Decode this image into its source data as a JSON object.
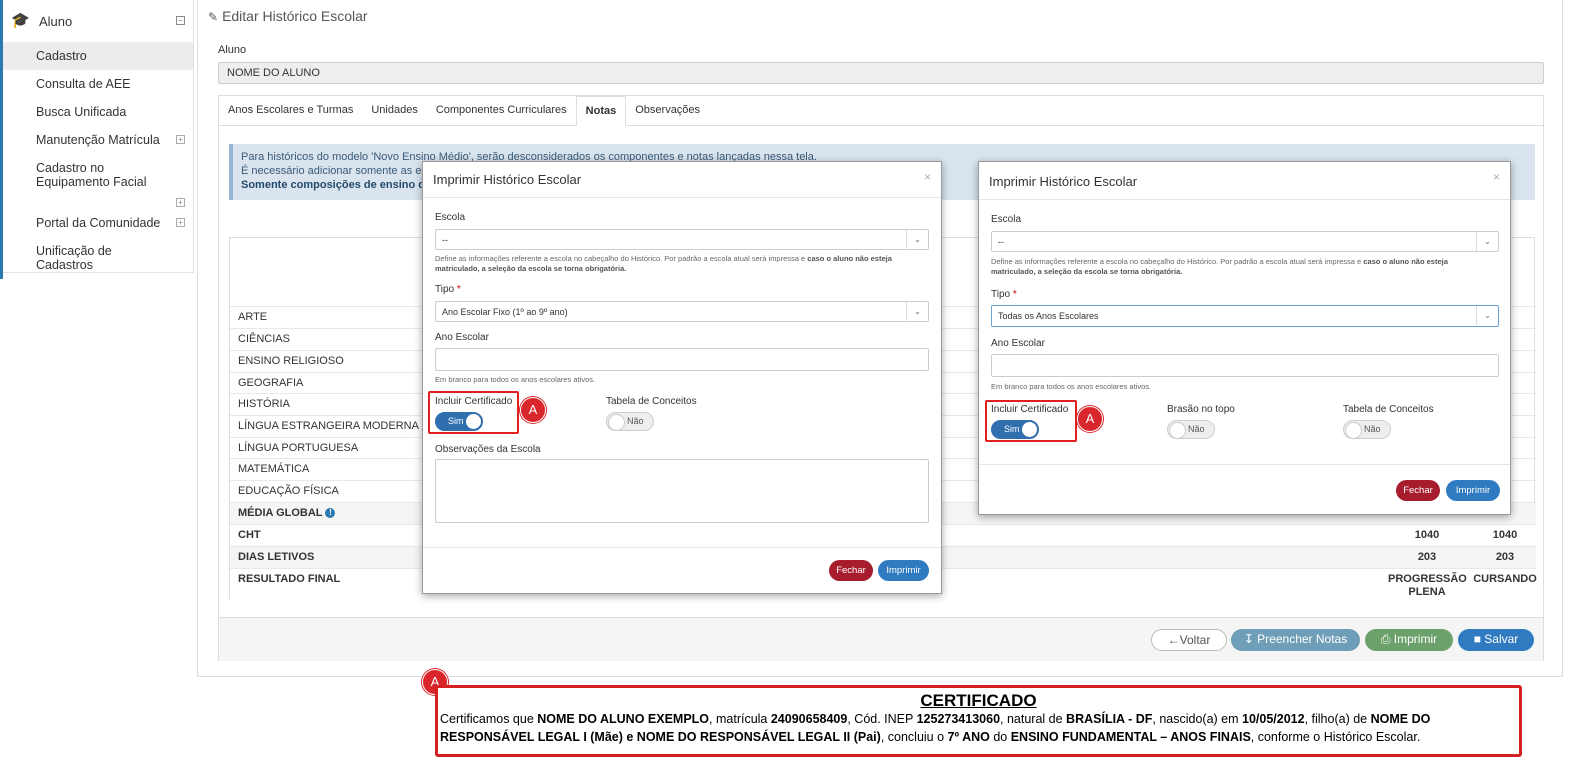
{
  "sidebar": {
    "section": "Aluno",
    "items": [
      {
        "label": "Cadastro"
      },
      {
        "label": "Consulta de AEE"
      },
      {
        "label": "Busca Unificada"
      },
      {
        "label": "Manutenção Matrícula"
      },
      {
        "label": "Cadastro no Equipamento Facial"
      },
      {
        "label": "Portal da Comunidade"
      },
      {
        "label": "Unificação de Cadastros"
      }
    ]
  },
  "page": {
    "title": "Editar Histórico Escolar",
    "aluno_label": "Aluno",
    "aluno_value": "NOME DO ALUNO"
  },
  "tabs": [
    "Anos Escolares e Turmas",
    "Unidades",
    "Componentes Curriculares",
    "Notas",
    "Observações"
  ],
  "info": {
    "line1": "Para históricos do modelo 'Novo Ensino Médio', serão desconsiderados os componentes e notas lançadas nessa tela.",
    "line2": "É necessário adicionar somente as escola",
    "line3": "Somente composições de ensino do tip"
  },
  "grades": {
    "subjects": [
      "ARTE",
      "CIÊNCIAS",
      "ENSINO RELIGIOSO",
      "GEOGRAFIA",
      "HISTÓRIA",
      "LÍNGUA ESTRANGEIRA MODERNA - INGLÊ",
      "LÍNGUA PORTUGUESA",
      "MATEMÁTICA",
      "EDUCAÇÃO FÍSICA"
    ],
    "media_global": "MÉDIA GLOBAL",
    "cht_label": "CHT",
    "cht_values": [
      "1040",
      "1040"
    ],
    "dias_label": "DIAS LETIVOS",
    "dias_values": [
      "203",
      "203"
    ],
    "resultado_label": "RESULTADO FINAL",
    "resultado_values": [
      "PROGRESSÃO PLENA",
      "CURSANDO"
    ]
  },
  "footer_buttons": {
    "voltar": "Voltar",
    "preencher": "Preencher Notas",
    "imprimir": "Imprimir",
    "salvar": "Salvar"
  },
  "modal1": {
    "title": "Imprimir Histórico Escolar",
    "escola_label": "Escola",
    "escola_value": "--",
    "escola_help_a": "Define as informações referente a escola no cabeçalho do Histórico. Por padrão a escola atual será impressa e ",
    "escola_help_b": "caso o aluno não esteja matriculado, a seleção da escola se torna obrigatória.",
    "tipo_label": "Tipo",
    "tipo_req": "*",
    "tipo_value": "Ano Escolar Fixo (1º ao 9º ano)",
    "ano_label": "Ano Escolar",
    "ano_help": "Em branco para todos os anos escolares ativos.",
    "certificado_label": "Incluir Certificado",
    "certificado_value": "Sim",
    "conceitos_label": "Tabela de Conceitos",
    "conceitos_value": "Não",
    "obs_label": "Observações da Escola",
    "fechar": "Fechar",
    "imprimir": "Imprimir",
    "close": "×"
  },
  "modal2": {
    "title": "Imprimir Histórico Escolar",
    "escola_label": "Escola",
    "escola_value": "--",
    "escola_help_a": "Define as informações referente a escola no cabeçalho do Histórico. Por padrão a escola atual será impressa e ",
    "escola_help_b": "caso o aluno não esteja matriculado, a seleção da escola se torna obrigatória.",
    "tipo_label": "Tipo",
    "tipo_req": "*",
    "tipo_value": "Todas os Anos Escolares",
    "ano_label": "Ano Escolar",
    "ano_help": "Em branco para todos os anos escolares ativos.",
    "certificado_label": "Incluir Certificado",
    "certificado_value": "Sim",
    "brasao_label": "Brasão no topo",
    "brasao_value": "Não",
    "conceitos_label": "Tabela de Conceitos",
    "conceitos_value": "Não",
    "fechar": "Fechar",
    "imprimir": "Imprimir",
    "close": "×"
  },
  "badges": [
    "A",
    "A",
    "A"
  ],
  "certificate": {
    "title": "CERTIFICADO",
    "t1": "Certificamos que ",
    "nome": "NOME DO ALUNO EXEMPLO",
    "t2": ", matrícula ",
    "matricula": "24090658409",
    "t3": ", Cód. INEP ",
    "inep": "125273413060",
    "t4": ", natural de ",
    "natural": "BRASÍLIA - DF",
    "t5": ", nascido(a) em ",
    "nascimento": "10/05/2012",
    "t6": ", filho(a) de ",
    "responsaveis": "NOME DO RESPONSÁVEL LEGAL I (Mãe) e NOME DO RESPONSÁVEL LEGAL II (Pai)",
    "t7": ", concluiu o  ",
    "ano": "7º ANO",
    "t8": " do ",
    "ensino": "ENSINO FUNDAMENTAL – ANOS FINAIS",
    "t9": ", conforme o Histórico Escolar."
  },
  "colors": {
    "primary": "#2f7ac0",
    "danger": "#a81d2e",
    "highlight": "#e02020",
    "info_bg": "#d9e4ef"
  }
}
